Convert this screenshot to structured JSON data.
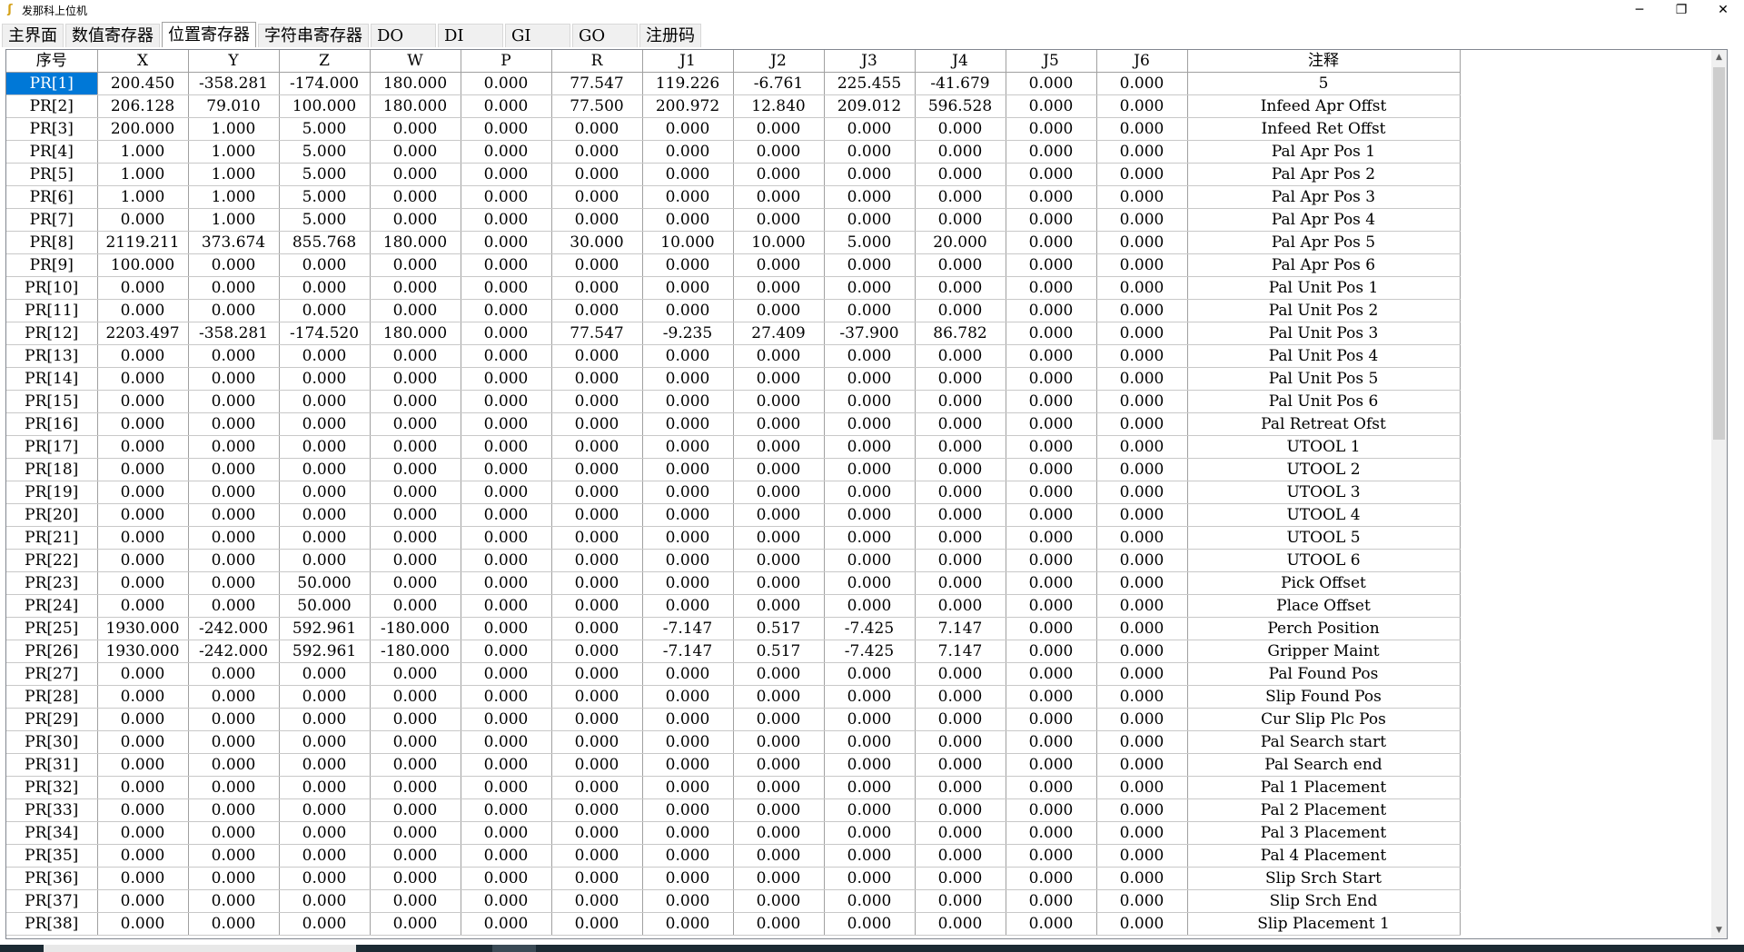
{
  "window": {
    "title": "发那科上位机",
    "icon": "app-logo-icon",
    "controls": {
      "minimize": "─",
      "maximize": "❐",
      "close": "✕"
    }
  },
  "tabs": [
    {
      "label": "主界面",
      "active": false
    },
    {
      "label": "数值寄存器",
      "active": false
    },
    {
      "label": "位置寄存器",
      "active": true
    },
    {
      "label": "字符串寄存器",
      "active": false
    },
    {
      "label": "DO",
      "active": false
    },
    {
      "label": "DI",
      "active": false
    },
    {
      "label": "GI",
      "active": false
    },
    {
      "label": "GO",
      "active": false
    },
    {
      "label": "注册码",
      "active": false
    }
  ],
  "grid": {
    "headers": [
      "序号",
      "X",
      "Y",
      "Z",
      "W",
      "P",
      "R",
      "J1",
      "J2",
      "J3",
      "J4",
      "J5",
      "J6",
      "注释"
    ],
    "selected_row": 0,
    "rows": [
      [
        "PR[1]",
        "200.450",
        "-358.281",
        "-174.000",
        "180.000",
        "0.000",
        "77.547",
        "119.226",
        "-6.761",
        "225.455",
        "-41.679",
        "0.000",
        "0.000",
        "5"
      ],
      [
        "PR[2]",
        "206.128",
        "79.010",
        "100.000",
        "180.000",
        "0.000",
        "77.500",
        "200.972",
        "12.840",
        "209.012",
        "596.528",
        "0.000",
        "0.000",
        "Infeed Apr Offst"
      ],
      [
        "PR[3]",
        "200.000",
        "1.000",
        "5.000",
        "0.000",
        "0.000",
        "0.000",
        "0.000",
        "0.000",
        "0.000",
        "0.000",
        "0.000",
        "0.000",
        "Infeed Ret Offst"
      ],
      [
        "PR[4]",
        "1.000",
        "1.000",
        "5.000",
        "0.000",
        "0.000",
        "0.000",
        "0.000",
        "0.000",
        "0.000",
        "0.000",
        "0.000",
        "0.000",
        "Pal Apr Pos 1"
      ],
      [
        "PR[5]",
        "1.000",
        "1.000",
        "5.000",
        "0.000",
        "0.000",
        "0.000",
        "0.000",
        "0.000",
        "0.000",
        "0.000",
        "0.000",
        "0.000",
        "Pal Apr Pos 2"
      ],
      [
        "PR[6]",
        "1.000",
        "1.000",
        "5.000",
        "0.000",
        "0.000",
        "0.000",
        "0.000",
        "0.000",
        "0.000",
        "0.000",
        "0.000",
        "0.000",
        "Pal Apr Pos 3"
      ],
      [
        "PR[7]",
        "0.000",
        "1.000",
        "5.000",
        "0.000",
        "0.000",
        "0.000",
        "0.000",
        "0.000",
        "0.000",
        "0.000",
        "0.000",
        "0.000",
        "Pal Apr Pos 4"
      ],
      [
        "PR[8]",
        "2119.211",
        "373.674",
        "855.768",
        "180.000",
        "0.000",
        "30.000",
        "10.000",
        "10.000",
        "5.000",
        "20.000",
        "0.000",
        "0.000",
        "Pal Apr Pos 5"
      ],
      [
        "PR[9]",
        "100.000",
        "0.000",
        "0.000",
        "0.000",
        "0.000",
        "0.000",
        "0.000",
        "0.000",
        "0.000",
        "0.000",
        "0.000",
        "0.000",
        "Pal Apr Pos 6"
      ],
      [
        "PR[10]",
        "0.000",
        "0.000",
        "0.000",
        "0.000",
        "0.000",
        "0.000",
        "0.000",
        "0.000",
        "0.000",
        "0.000",
        "0.000",
        "0.000",
        "Pal Unit Pos 1"
      ],
      [
        "PR[11]",
        "0.000",
        "0.000",
        "0.000",
        "0.000",
        "0.000",
        "0.000",
        "0.000",
        "0.000",
        "0.000",
        "0.000",
        "0.000",
        "0.000",
        "Pal Unit Pos 2"
      ],
      [
        "PR[12]",
        "2203.497",
        "-358.281",
        "-174.520",
        "180.000",
        "0.000",
        "77.547",
        "-9.235",
        "27.409",
        "-37.900",
        "86.782",
        "0.000",
        "0.000",
        "Pal Unit Pos 3"
      ],
      [
        "PR[13]",
        "0.000",
        "0.000",
        "0.000",
        "0.000",
        "0.000",
        "0.000",
        "0.000",
        "0.000",
        "0.000",
        "0.000",
        "0.000",
        "0.000",
        "Pal Unit Pos 4"
      ],
      [
        "PR[14]",
        "0.000",
        "0.000",
        "0.000",
        "0.000",
        "0.000",
        "0.000",
        "0.000",
        "0.000",
        "0.000",
        "0.000",
        "0.000",
        "0.000",
        "Pal Unit Pos 5"
      ],
      [
        "PR[15]",
        "0.000",
        "0.000",
        "0.000",
        "0.000",
        "0.000",
        "0.000",
        "0.000",
        "0.000",
        "0.000",
        "0.000",
        "0.000",
        "0.000",
        "Pal Unit Pos 6"
      ],
      [
        "PR[16]",
        "0.000",
        "0.000",
        "0.000",
        "0.000",
        "0.000",
        "0.000",
        "0.000",
        "0.000",
        "0.000",
        "0.000",
        "0.000",
        "0.000",
        "Pal Retreat Ofst"
      ],
      [
        "PR[17]",
        "0.000",
        "0.000",
        "0.000",
        "0.000",
        "0.000",
        "0.000",
        "0.000",
        "0.000",
        "0.000",
        "0.000",
        "0.000",
        "0.000",
        "UTOOL 1"
      ],
      [
        "PR[18]",
        "0.000",
        "0.000",
        "0.000",
        "0.000",
        "0.000",
        "0.000",
        "0.000",
        "0.000",
        "0.000",
        "0.000",
        "0.000",
        "0.000",
        "UTOOL 2"
      ],
      [
        "PR[19]",
        "0.000",
        "0.000",
        "0.000",
        "0.000",
        "0.000",
        "0.000",
        "0.000",
        "0.000",
        "0.000",
        "0.000",
        "0.000",
        "0.000",
        "UTOOL 3"
      ],
      [
        "PR[20]",
        "0.000",
        "0.000",
        "0.000",
        "0.000",
        "0.000",
        "0.000",
        "0.000",
        "0.000",
        "0.000",
        "0.000",
        "0.000",
        "0.000",
        "UTOOL 4"
      ],
      [
        "PR[21]",
        "0.000",
        "0.000",
        "0.000",
        "0.000",
        "0.000",
        "0.000",
        "0.000",
        "0.000",
        "0.000",
        "0.000",
        "0.000",
        "0.000",
        "UTOOL 5"
      ],
      [
        "PR[22]",
        "0.000",
        "0.000",
        "0.000",
        "0.000",
        "0.000",
        "0.000",
        "0.000",
        "0.000",
        "0.000",
        "0.000",
        "0.000",
        "0.000",
        "UTOOL 6"
      ],
      [
        "PR[23]",
        "0.000",
        "0.000",
        "50.000",
        "0.000",
        "0.000",
        "0.000",
        "0.000",
        "0.000",
        "0.000",
        "0.000",
        "0.000",
        "0.000",
        "Pick Offset"
      ],
      [
        "PR[24]",
        "0.000",
        "0.000",
        "50.000",
        "0.000",
        "0.000",
        "0.000",
        "0.000",
        "0.000",
        "0.000",
        "0.000",
        "0.000",
        "0.000",
        "Place Offset"
      ],
      [
        "PR[25]",
        "1930.000",
        "-242.000",
        "592.961",
        "-180.000",
        "0.000",
        "0.000",
        "-7.147",
        "0.517",
        "-7.425",
        "7.147",
        "0.000",
        "0.000",
        "Perch Position"
      ],
      [
        "PR[26]",
        "1930.000",
        "-242.000",
        "592.961",
        "-180.000",
        "0.000",
        "0.000",
        "-7.147",
        "0.517",
        "-7.425",
        "7.147",
        "0.000",
        "0.000",
        "Gripper Maint"
      ],
      [
        "PR[27]",
        "0.000",
        "0.000",
        "0.000",
        "0.000",
        "0.000",
        "0.000",
        "0.000",
        "0.000",
        "0.000",
        "0.000",
        "0.000",
        "0.000",
        "Pal Found Pos"
      ],
      [
        "PR[28]",
        "0.000",
        "0.000",
        "0.000",
        "0.000",
        "0.000",
        "0.000",
        "0.000",
        "0.000",
        "0.000",
        "0.000",
        "0.000",
        "0.000",
        "Slip Found Pos"
      ],
      [
        "PR[29]",
        "0.000",
        "0.000",
        "0.000",
        "0.000",
        "0.000",
        "0.000",
        "0.000",
        "0.000",
        "0.000",
        "0.000",
        "0.000",
        "0.000",
        "Cur Slip Plc Pos"
      ],
      [
        "PR[30]",
        "0.000",
        "0.000",
        "0.000",
        "0.000",
        "0.000",
        "0.000",
        "0.000",
        "0.000",
        "0.000",
        "0.000",
        "0.000",
        "0.000",
        "Pal Search start"
      ],
      [
        "PR[31]",
        "0.000",
        "0.000",
        "0.000",
        "0.000",
        "0.000",
        "0.000",
        "0.000",
        "0.000",
        "0.000",
        "0.000",
        "0.000",
        "0.000",
        "Pal Search end"
      ],
      [
        "PR[32]",
        "0.000",
        "0.000",
        "0.000",
        "0.000",
        "0.000",
        "0.000",
        "0.000",
        "0.000",
        "0.000",
        "0.000",
        "0.000",
        "0.000",
        "Pal 1 Placement"
      ],
      [
        "PR[33]",
        "0.000",
        "0.000",
        "0.000",
        "0.000",
        "0.000",
        "0.000",
        "0.000",
        "0.000",
        "0.000",
        "0.000",
        "0.000",
        "0.000",
        "Pal 2 Placement"
      ],
      [
        "PR[34]",
        "0.000",
        "0.000",
        "0.000",
        "0.000",
        "0.000",
        "0.000",
        "0.000",
        "0.000",
        "0.000",
        "0.000",
        "0.000",
        "0.000",
        "Pal 3 Placement"
      ],
      [
        "PR[35]",
        "0.000",
        "0.000",
        "0.000",
        "0.000",
        "0.000",
        "0.000",
        "0.000",
        "0.000",
        "0.000",
        "0.000",
        "0.000",
        "0.000",
        "Pal 4 Placement"
      ],
      [
        "PR[36]",
        "0.000",
        "0.000",
        "0.000",
        "0.000",
        "0.000",
        "0.000",
        "0.000",
        "0.000",
        "0.000",
        "0.000",
        "0.000",
        "0.000",
        "Slip Srch Start"
      ],
      [
        "PR[37]",
        "0.000",
        "0.000",
        "0.000",
        "0.000",
        "0.000",
        "0.000",
        "0.000",
        "0.000",
        "0.000",
        "0.000",
        "0.000",
        "0.000",
        "Slip Srch End"
      ],
      [
        "PR[38]",
        "0.000",
        "0.000",
        "0.000",
        "0.000",
        "0.000",
        "0.000",
        "0.000",
        "0.000",
        "0.000",
        "0.000",
        "0.000",
        "0.000",
        "Slip Placement 1"
      ]
    ]
  },
  "colors": {
    "selection": "#0078d7",
    "grid_line": "#a0a0a0",
    "taskbar": "#1b2a33"
  }
}
